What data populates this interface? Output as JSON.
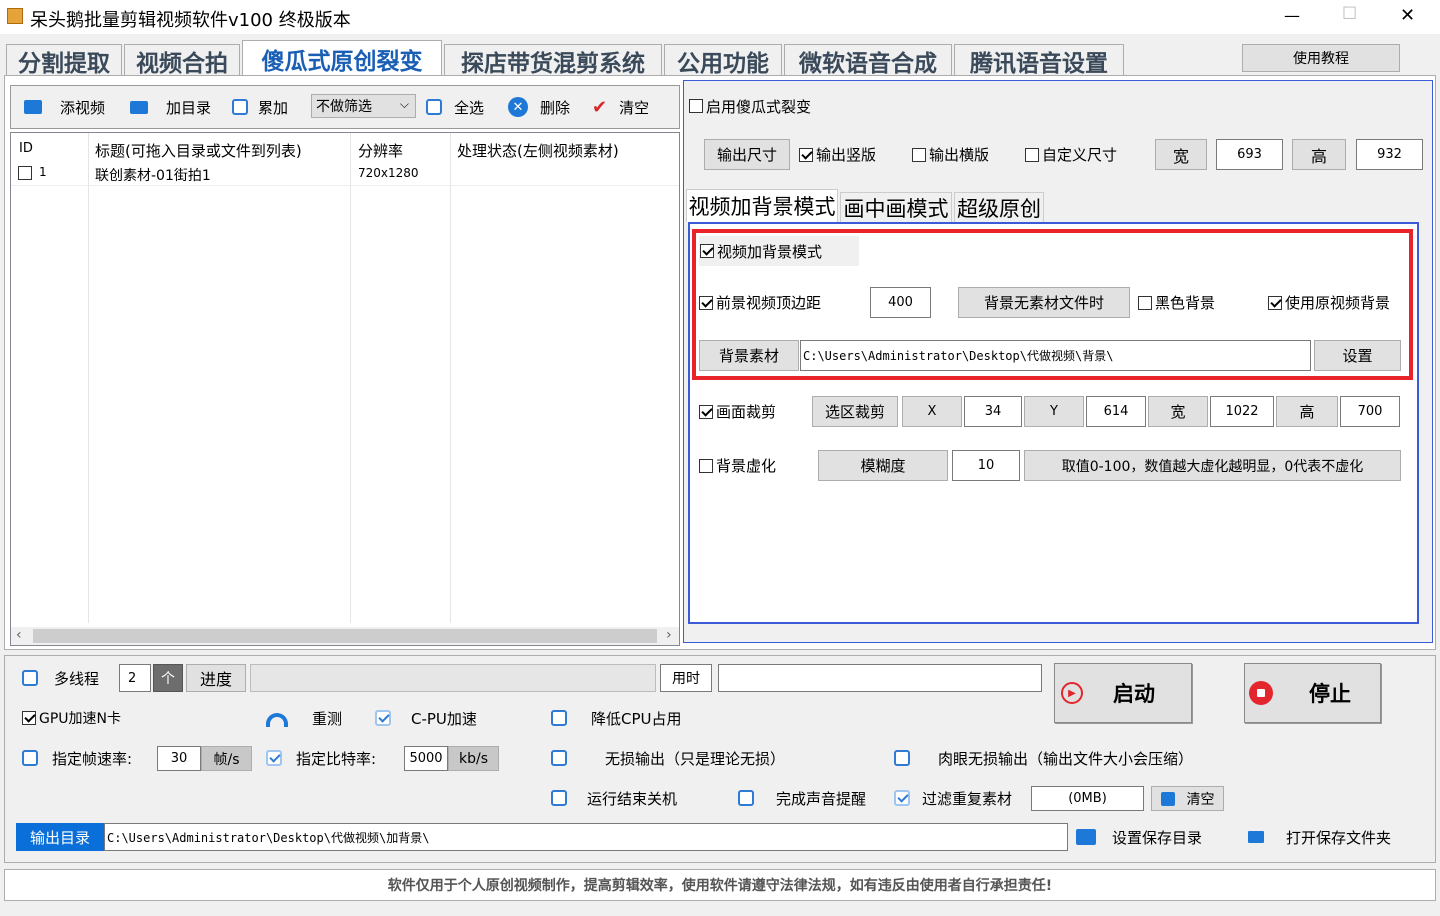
{
  "window": {
    "title": "呆头鹅批量剪辑视频软件v100 终极版本",
    "min": "—",
    "max": "☐",
    "close": "✕"
  },
  "tabs": [
    "分割提取",
    "视频合拍",
    "傻瓜式原创裂变",
    "探店带货混剪系统",
    "公用功能",
    "微软语音合成",
    "腾讯语音设置"
  ],
  "help_button": "使用教程",
  "toolbar": {
    "add_video": "添视频",
    "add_dir": "加目录",
    "accumulate": "累加",
    "filter_value": "不做筛选",
    "select_all": "全选",
    "delete": "删除",
    "clear": "清空"
  },
  "table": {
    "columns": [
      "ID",
      "标题(可拖入目录或文件到列表)",
      "分辨率",
      "处理状态(左侧视频素材)"
    ],
    "rows": [
      {
        "id": "1",
        "title": "联创素材-01街拍1",
        "resolution": "720x1280",
        "status": ""
      }
    ]
  },
  "right": {
    "enable_label": "启用傻瓜式裂变",
    "output_size_btn": "输出尺寸",
    "output_portrait": "输出竖版",
    "output_landscape": "输出横版",
    "custom_size": "自定义尺寸",
    "width_label": "宽",
    "width_value": "693",
    "height_label": "高",
    "height_value": "932",
    "subtabs": [
      "视频加背景模式",
      "画中画模式",
      "超级原创"
    ],
    "bg_mode_label": "视频加背景模式",
    "fg_margin_label": "前景视频顶边距",
    "fg_margin_value": "400",
    "no_bg_btn": "背景无素材文件时",
    "black_bg": "黑色背景",
    "use_orig_bg": "使用原视频背景",
    "bg_material_btn": "背景素材",
    "bg_path": "C:\\Users\\Administrator\\Desktop\\代做视频\\背景\\",
    "set_btn": "设置",
    "crop_label": "画面裁剪",
    "select_crop_btn": "选区裁剪",
    "x_label": "X",
    "x_value": "34",
    "y_label": "Y",
    "y_value": "614",
    "w_label": "宽",
    "w_value": "1022",
    "h_label": "高",
    "h_value": "700",
    "blur_label": "背景虚化",
    "blur_btn": "模糊度",
    "blur_value": "10",
    "blur_hint": "取值0-100，数值越大虚化越明显，0代表不虚化"
  },
  "bottom": {
    "multithread": "多线程",
    "thread_count": "2",
    "thread_unit": "个",
    "progress_label": "进度",
    "progress_value": 0,
    "time_label": "用时",
    "time_value": "",
    "start": "启动",
    "stop": "停止",
    "gpu_label": "GPU加速N卡",
    "retest": "重测",
    "cpu_accel": "C-PU加速",
    "reduce_cpu": "降低CPU占用",
    "fps_label": "指定帧速率:",
    "fps_value": "30",
    "fps_unit": "帧/s",
    "bitrate_label": "指定比特率:",
    "bitrate_value": "5000",
    "bitrate_unit": "kb/s",
    "lossless": "无损输出（只是理论无损）",
    "visual_lossless": "肉眼无损输出（输出文件大小会压缩）",
    "shutdown": "运行结束关机",
    "sound_alert": "完成声音提醒",
    "filter_dup": "过滤重复素材",
    "dup_size": "(0MB)",
    "dup_clear": "清空",
    "output_dir_label": "输出目录",
    "output_dir": "C:\\Users\\Administrator\\Desktop\\代做视频\\加背景\\",
    "set_save_dir": "设置保存目录",
    "open_save_dir": "打开保存文件夹"
  },
  "footer": "软件仅用于个人原创视频制作，提高剪辑效率，使用软件请遵守法律法规，如有违反由使用者自行承担责任!",
  "colors": {
    "highlight": "#e8232a",
    "accent": "#1a5fb4",
    "panel_border": "#3b5bd9"
  }
}
